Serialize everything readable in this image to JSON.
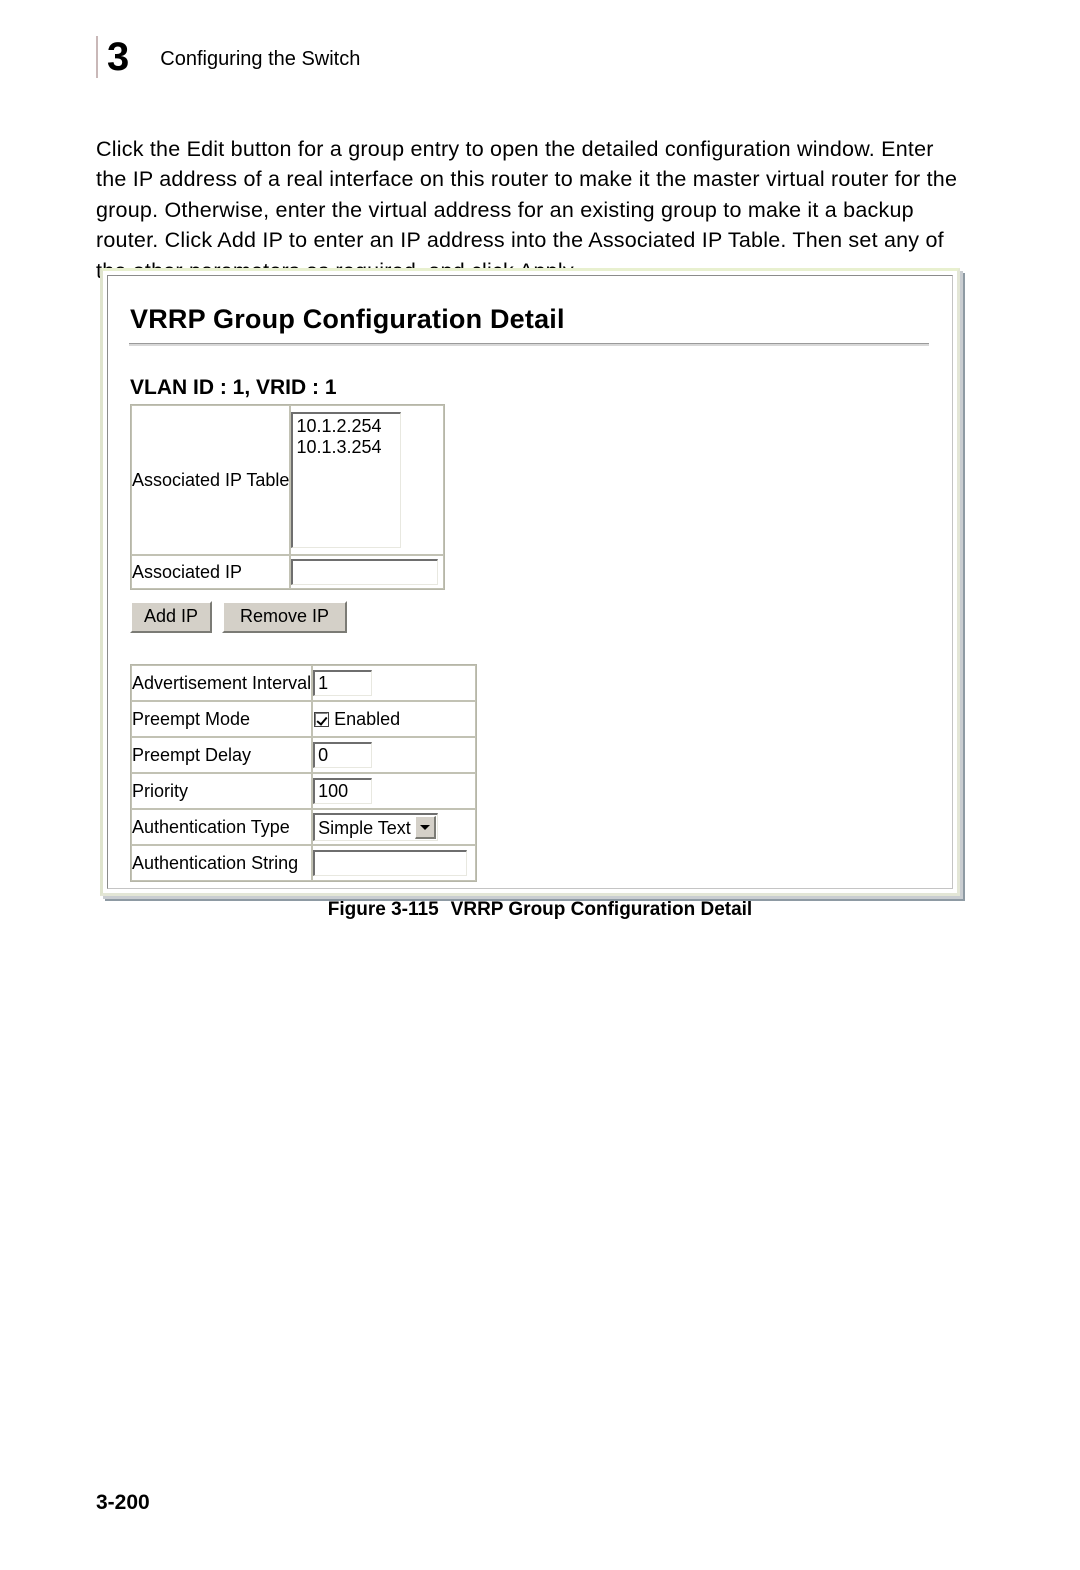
{
  "page": {
    "chapter_number": "3",
    "chapter_title": "Configuring the Switch",
    "page_number": "3-200",
    "body_text": "Click the Edit button for a group entry to open the detailed configuration window. Enter the IP address of a real interface on this router to make it the master virtual router for the group. Otherwise, enter the virtual address for an existing group to make it a backup router. Click Add IP to enter an IP address into the Associated IP Table. Then set any of the other parameters as required, and click Apply."
  },
  "figure": {
    "caption_label": "Figure 3-115",
    "caption_title": "VRRP Group Configuration Detail"
  },
  "screenshot": {
    "panel_title": "VRRP Group Configuration Detail",
    "vlan_heading": "VLAN ID : 1, VRID : 1",
    "associated_ip_table": {
      "label": "Associated IP Table",
      "entries": [
        "10.1.2.254",
        "10.1.3.254"
      ]
    },
    "associated_ip": {
      "label": "Associated IP",
      "value": "",
      "placeholder": ""
    },
    "buttons": {
      "add_ip": "Add IP",
      "remove_ip": "Remove IP"
    },
    "parameters": [
      {
        "label": "Advertisement Interval",
        "type": "text",
        "value": "1"
      },
      {
        "label": "Preempt Mode",
        "type": "checkbox",
        "value": "Enabled",
        "checked": true
      },
      {
        "label": "Preempt Delay",
        "type": "text",
        "value": "0"
      },
      {
        "label": "Priority",
        "type": "text",
        "value": "100"
      },
      {
        "label": "Authentication Type",
        "type": "select",
        "value": "Simple Text"
      },
      {
        "label": "Authentication String",
        "type": "text",
        "value": ""
      }
    ]
  },
  "colors": {
    "frame_border": "#e8f0cf",
    "frame_shadow": "#8e9aa3",
    "field_bevel": "#6e6e6e",
    "button_face": "#d4d0c8",
    "table_border": "#c2c2b4"
  }
}
